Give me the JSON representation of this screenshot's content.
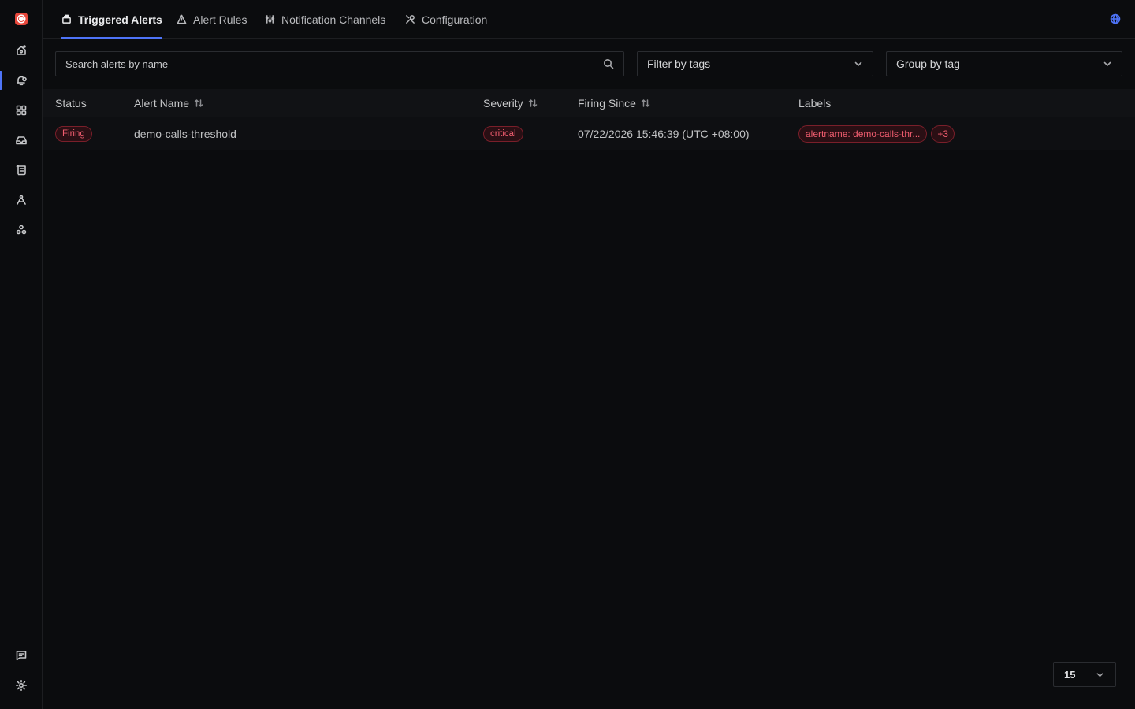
{
  "sidebar": {
    "items": [
      {
        "name": "home-icon"
      },
      {
        "name": "alerts-bell-icon",
        "active": true
      },
      {
        "name": "dashboards-grid-icon"
      },
      {
        "name": "infrastructure-icon"
      },
      {
        "name": "logs-icon"
      },
      {
        "name": "traces-icon"
      },
      {
        "name": "integrations-icon"
      }
    ],
    "bottom": [
      {
        "name": "support-chat-icon"
      },
      {
        "name": "settings-gear-icon"
      }
    ]
  },
  "tabs": [
    {
      "label": "Triggered Alerts",
      "icon": "triggered-alerts-icon",
      "active": true
    },
    {
      "label": "Alert Rules",
      "icon": "alert-rules-icon"
    },
    {
      "label": "Notification Channels",
      "icon": "notification-channels-icon"
    },
    {
      "label": "Configuration",
      "icon": "configuration-icon"
    }
  ],
  "search": {
    "placeholder": "Search alerts by name"
  },
  "filter": {
    "label": "Filter by tags"
  },
  "group": {
    "label": "Group by tag"
  },
  "table": {
    "columns": [
      "Status",
      "Alert Name",
      "Severity",
      "Firing Since",
      "Labels"
    ],
    "rows": [
      {
        "status": "Firing",
        "alert_name": "demo-calls-threshold",
        "severity": "critical",
        "firing_since": "07/22/2026 15:46:39 (UTC +08:00)",
        "label": "alertname: demo-calls-thr...",
        "more_labels": "+3"
      }
    ]
  },
  "pagination": {
    "page_size": "15"
  },
  "colors": {
    "accent": "#4e74f8",
    "danger": "#f05d6f",
    "background": "#0b0c0e"
  }
}
